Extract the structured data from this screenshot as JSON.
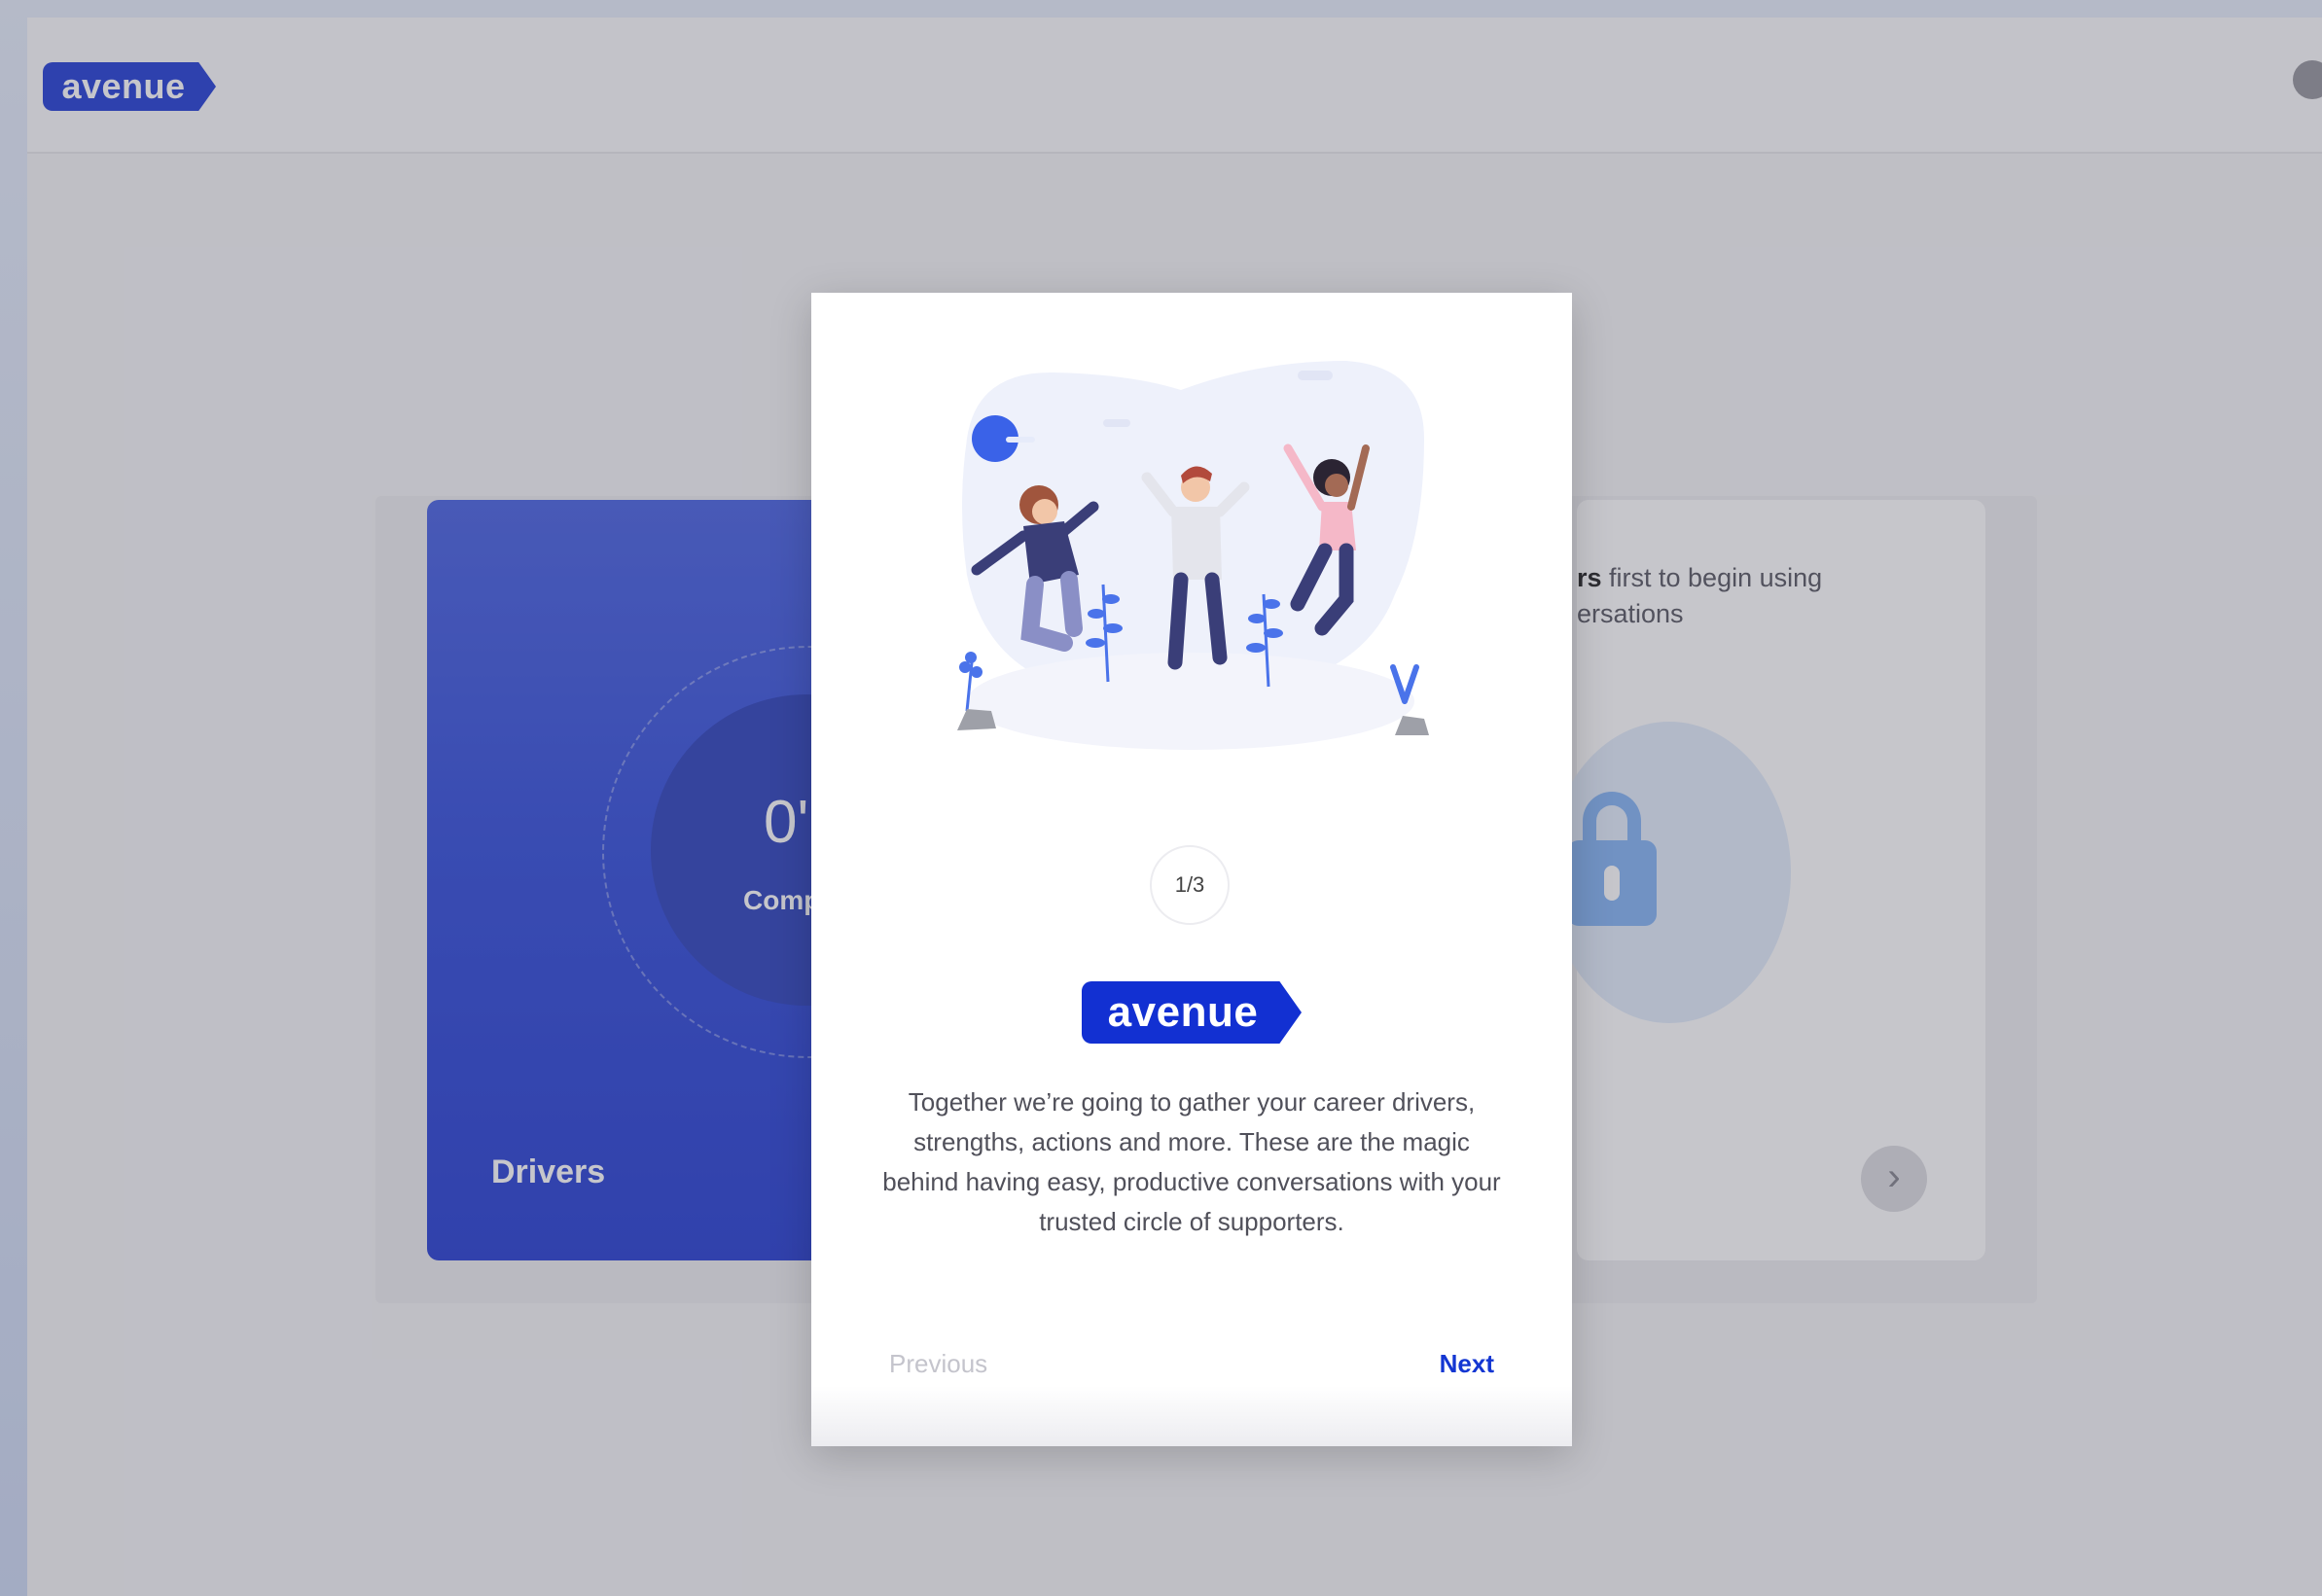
{
  "app": {
    "brand": "avenue"
  },
  "background": {
    "drivers_card": {
      "percent": "0'",
      "complete": "Comp",
      "title": "Drivers"
    },
    "right_card": {
      "line1_bold": "rs",
      "line1_rest": " first to begin using",
      "line2": "ersations",
      "next_glyph": "›"
    }
  },
  "modal": {
    "step": "1/3",
    "brand": "avenue",
    "description": "Together we’re going to gather your career drivers, strengths, actions and more. These are the magic behind having easy, productive conversations with your trusted circle of supporters.",
    "previous_label": "Previous",
    "next_label": "Next"
  },
  "colors": {
    "brand_blue": "#1230d2",
    "next_blue": "#1336d2",
    "card_gradient_top": "#3b56e0",
    "card_gradient_bottom": "#1630cf"
  },
  "icons": {
    "gear": "gear-icon",
    "lock": "lock-icon",
    "chevron": "chevron-right-icon"
  }
}
